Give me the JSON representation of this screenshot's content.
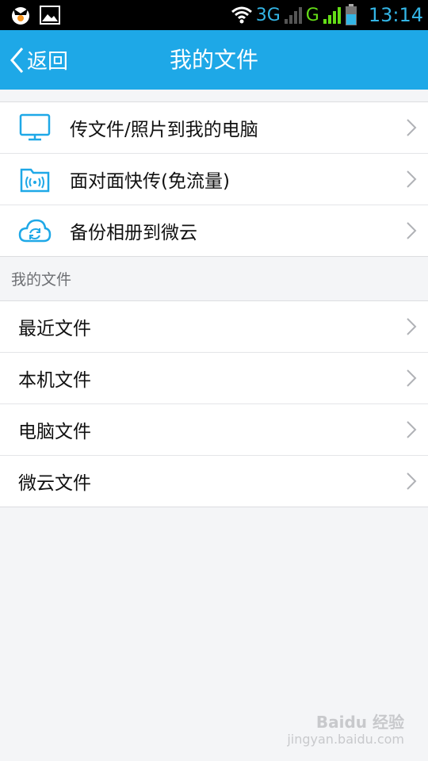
{
  "status_bar": {
    "network_3g": "3G",
    "network_g": "G",
    "time": "13:14",
    "icons": [
      "app-notification-icon",
      "image-notification-icon",
      "wifi-icon",
      "signal-icon",
      "battery-icon"
    ]
  },
  "title_bar": {
    "back_label": "返回",
    "title": "我的文件"
  },
  "actions": [
    {
      "label": "传文件/照片到我的电脑",
      "icon": "monitor-icon"
    },
    {
      "label": "面对面快传(免流量)",
      "icon": "wireless-folder-icon"
    },
    {
      "label": "备份相册到微云",
      "icon": "cloud-sync-icon"
    }
  ],
  "section_header": "我的文件",
  "files": [
    {
      "label": "最近文件"
    },
    {
      "label": "本机文件"
    },
    {
      "label": "电脑文件"
    },
    {
      "label": "微云文件"
    }
  ],
  "watermark": {
    "brand": "Baidu 经验",
    "url": "jingyan.baidu.com"
  },
  "colors": {
    "accent": "#1ea8e7",
    "background": "#f4f5f7",
    "status_blue": "#33b5e5",
    "status_green": "#64dd17"
  }
}
